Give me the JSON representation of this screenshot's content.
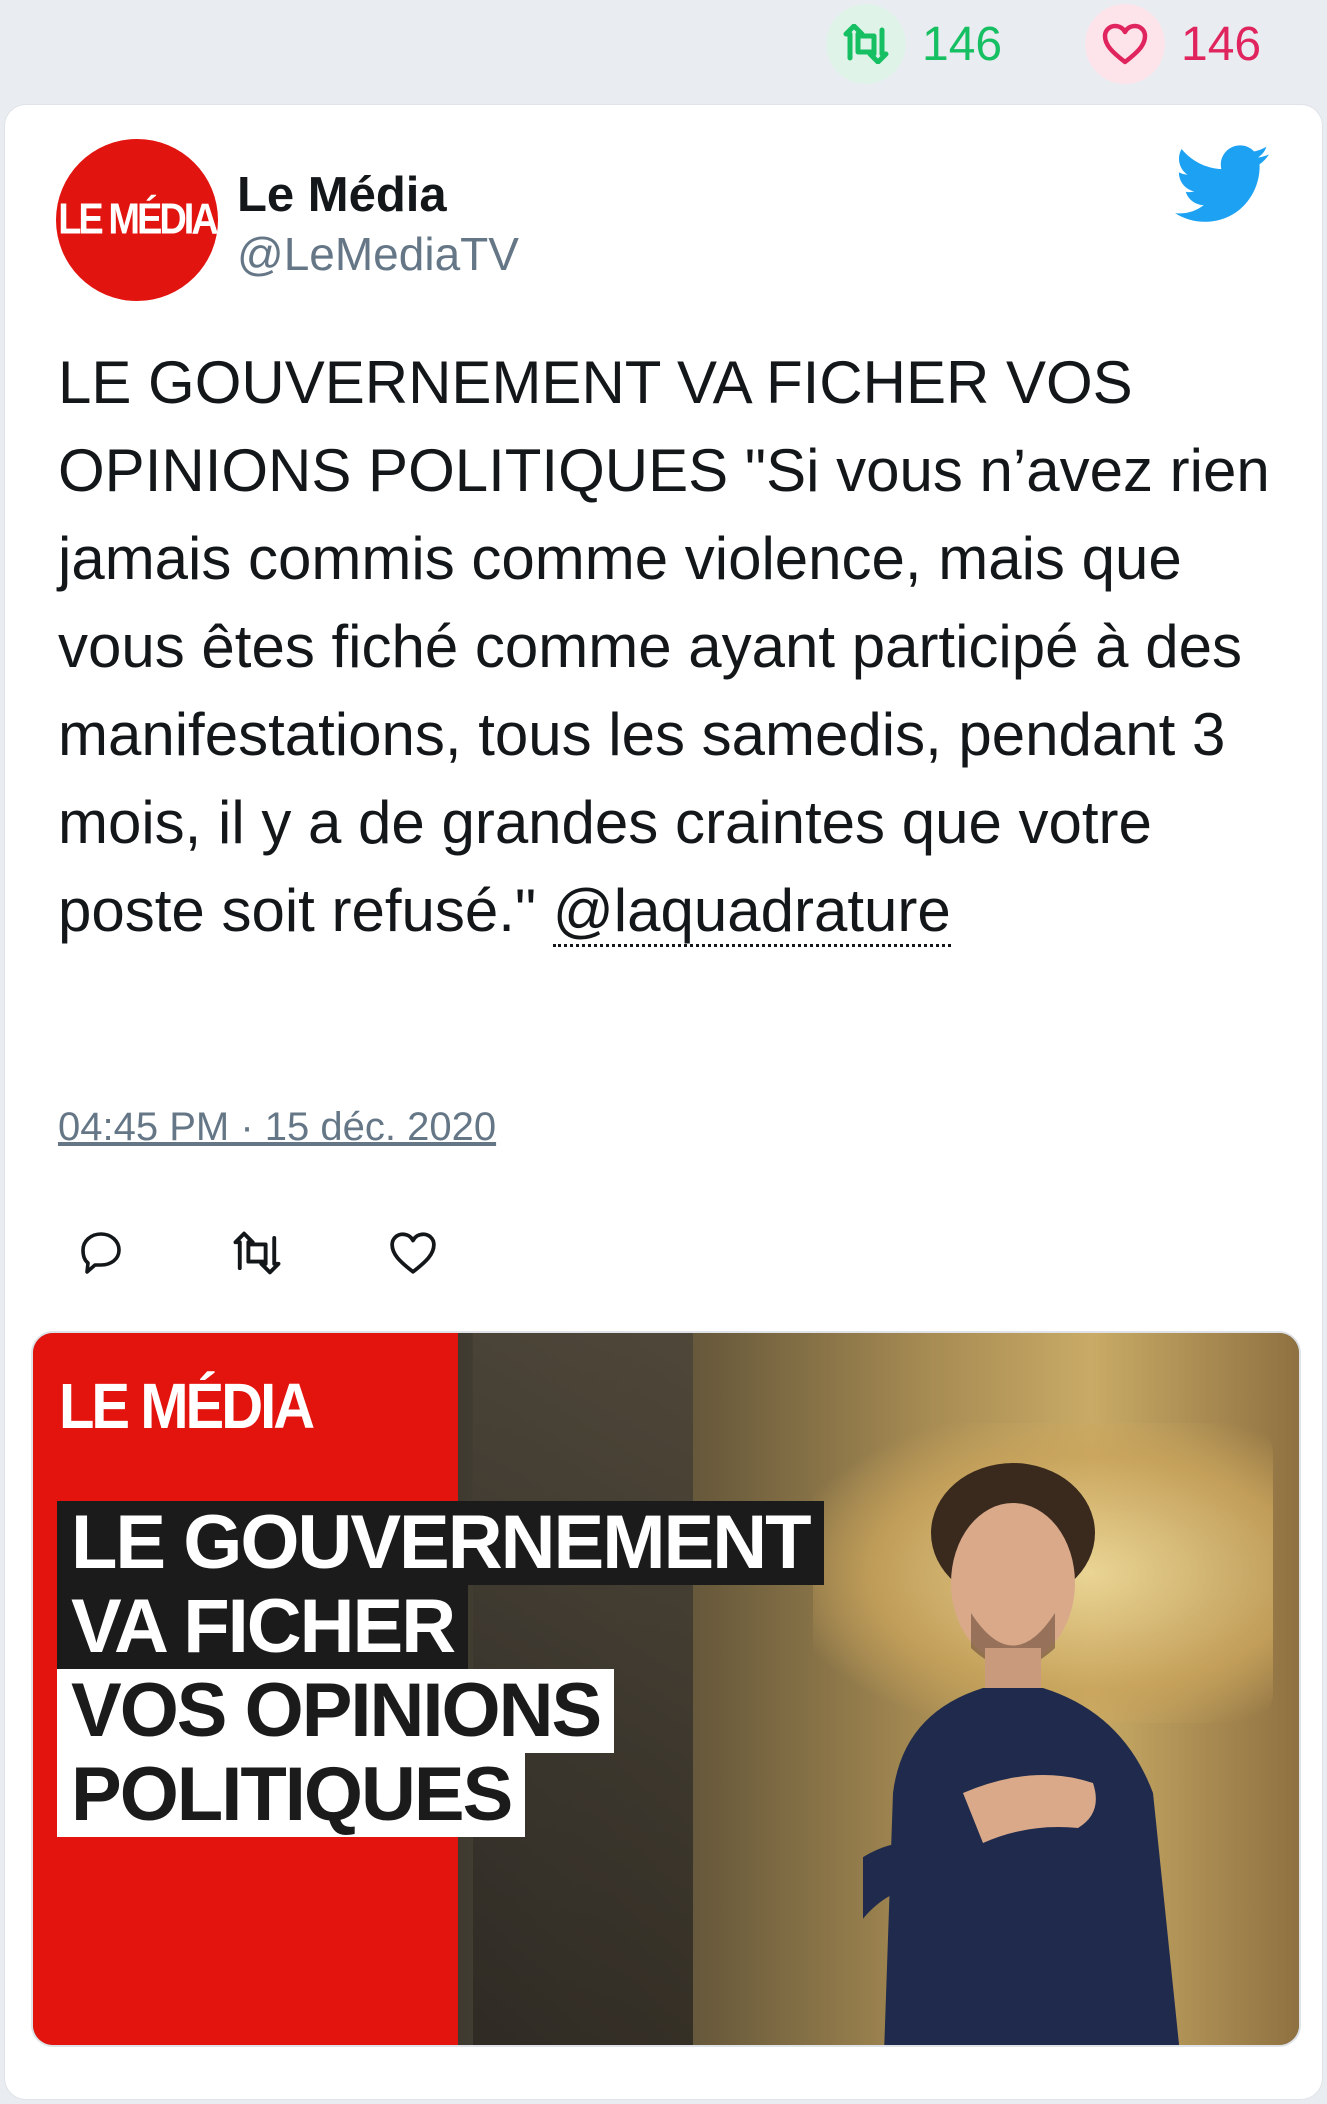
{
  "stats": {
    "retweet_count": "146",
    "like_count": "146"
  },
  "tweet": {
    "author_name": "Le Média",
    "author_handle": "@LeMediaTV",
    "avatar_text": "LE MÉDIA",
    "text_main": "LE GOUVERNEMENT VA FICHER VOS OPINIONS POLITIQUES \"Si vous n’avez rien jamais commis comme violence, mais que vous êtes fiché comme ayant participé à des manifestations, tous les samedis, pendant 3 mois, il y a de grandes craintes que votre poste soit refusé.\" ",
    "mention": "@laquadrature",
    "timestamp": "04:45 PM · 15 déc. 2020"
  },
  "media": {
    "logo_text": "LE MÉDIA",
    "headline": [
      "LE GOUVERNEMENT",
      "VA FICHER",
      "VOS OPINIONS",
      "POLITIQUES"
    ]
  },
  "colors": {
    "retweet_green": "#17bf63",
    "like_red": "#e0245e",
    "twitter_blue": "#1da1f2",
    "brand_red": "#e3130e"
  },
  "icons": {
    "retweet": "retweet-icon",
    "like": "heart-icon",
    "reply": "reply-icon",
    "brand": "twitter-bird-icon"
  }
}
